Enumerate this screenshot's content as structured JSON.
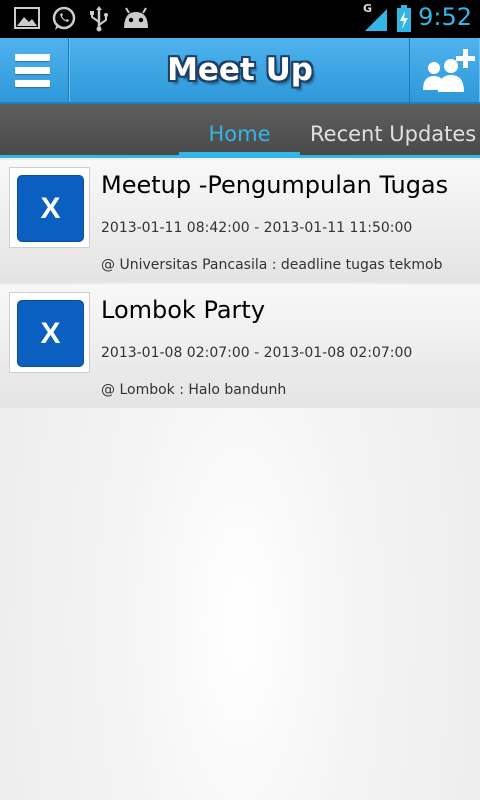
{
  "status_bar": {
    "time": "9:52",
    "network_label": "G",
    "icons": [
      "gallery-icon",
      "whatsapp-icon",
      "usb-icon",
      "android-debug-icon",
      "signal-icon",
      "battery-charging-icon"
    ]
  },
  "action_bar": {
    "title": "Meet Up",
    "left_icon": "menu-icon",
    "right_icon": "add-group-icon"
  },
  "tabs": [
    {
      "label": "Home",
      "selected": true
    },
    {
      "label": "Recent Updates",
      "selected": false
    }
  ],
  "events": [
    {
      "thumbnail_letter": "X",
      "title": "Meetup -Pengumpulan Tugas",
      "time_range": "2013-01-11 08:42:00 - 2013-01-11 11:50:00",
      "location": "@ Universitas Pancasila : deadline tugas tekmob"
    },
    {
      "thumbnail_letter": "X",
      "title": "Lombok Party",
      "time_range": "2013-01-08 02:07:00 - 2013-01-08 02:07:00",
      "location": "@ Lombok : Halo bandunh"
    }
  ],
  "colors": {
    "accent": "#33b5e5",
    "action_bar": "#3aa6e4",
    "tab_bar": "#555555",
    "thumbnail_tile": "#0b5fc0"
  }
}
